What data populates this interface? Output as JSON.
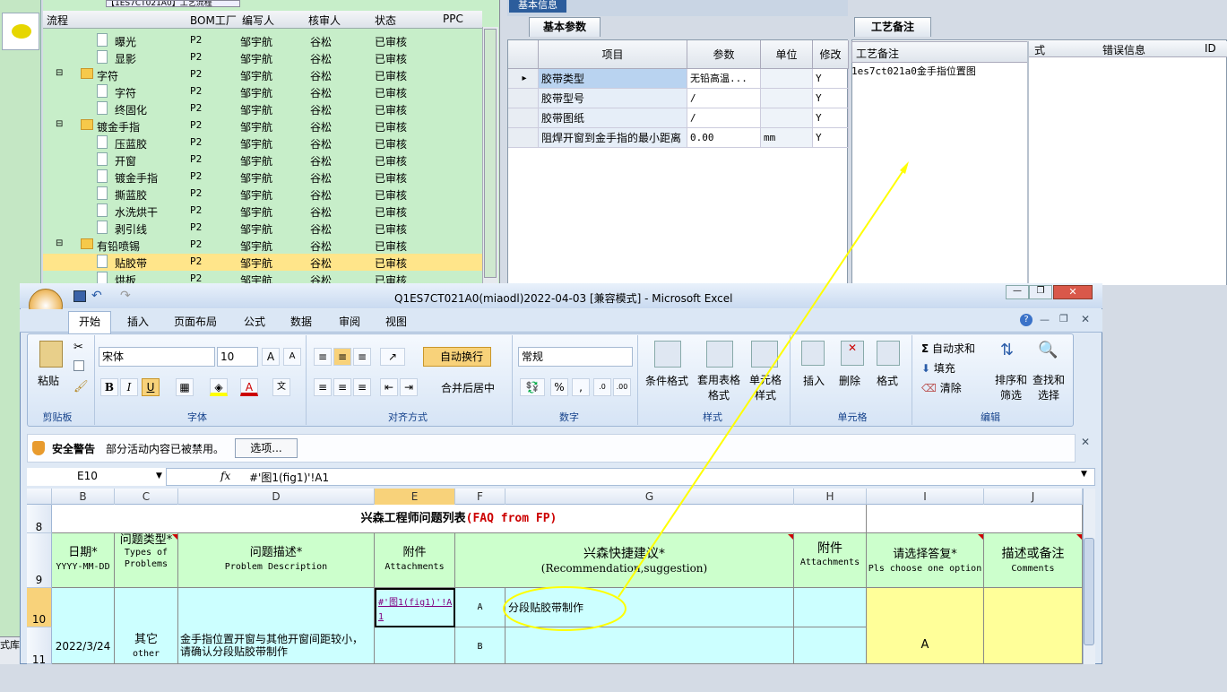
{
  "tree_panel": {
    "top_label": "【1ES7CT021A0】工艺流程",
    "headers": [
      "流程",
      "BOM工厂",
      "编写人",
      "核审人",
      "状态",
      "PPC"
    ],
    "rows": [
      {
        "name": "曝光",
        "indent": 2,
        "folder": false,
        "bom": "P2",
        "writer": "邹宇航",
        "reviewer": "谷松",
        "status": "已审核"
      },
      {
        "name": "显影",
        "indent": 2,
        "folder": false,
        "bom": "P2",
        "writer": "邹宇航",
        "reviewer": "谷松",
        "status": "已审核"
      },
      {
        "name": "字符",
        "indent": 1,
        "folder": true,
        "bom": "P2",
        "writer": "邹宇航",
        "reviewer": "谷松",
        "status": "已审核"
      },
      {
        "name": "字符",
        "indent": 2,
        "folder": false,
        "bom": "P2",
        "writer": "邹宇航",
        "reviewer": "谷松",
        "status": "已审核"
      },
      {
        "name": "终固化",
        "indent": 2,
        "folder": false,
        "bom": "P2",
        "writer": "邹宇航",
        "reviewer": "谷松",
        "status": "已审核"
      },
      {
        "name": "镀金手指",
        "indent": 1,
        "folder": true,
        "bom": "P2",
        "writer": "邹宇航",
        "reviewer": "谷松",
        "status": "已审核"
      },
      {
        "name": "压蓝胶",
        "indent": 2,
        "folder": false,
        "bom": "P2",
        "writer": "邹宇航",
        "reviewer": "谷松",
        "status": "已审核"
      },
      {
        "name": "开窗",
        "indent": 2,
        "folder": false,
        "bom": "P2",
        "writer": "邹宇航",
        "reviewer": "谷松",
        "status": "已审核"
      },
      {
        "name": "镀金手指",
        "indent": 2,
        "folder": false,
        "bom": "P2",
        "writer": "邹宇航",
        "reviewer": "谷松",
        "status": "已审核"
      },
      {
        "name": "撕蓝胶",
        "indent": 2,
        "folder": false,
        "bom": "P2",
        "writer": "邹宇航",
        "reviewer": "谷松",
        "status": "已审核"
      },
      {
        "name": "水洗烘干",
        "indent": 2,
        "folder": false,
        "bom": "P2",
        "writer": "邹宇航",
        "reviewer": "谷松",
        "status": "已审核"
      },
      {
        "name": "剥引线",
        "indent": 2,
        "folder": false,
        "bom": "P2",
        "writer": "邹宇航",
        "reviewer": "谷松",
        "status": "已审核"
      },
      {
        "name": "有铅喷锡",
        "indent": 1,
        "folder": true,
        "bom": "P2",
        "writer": "邹宇航",
        "reviewer": "谷松",
        "status": "已审核"
      },
      {
        "name": "贴胶带",
        "indent": 2,
        "folder": false,
        "bom": "P2",
        "writer": "邹宇航",
        "reviewer": "谷松",
        "status": "已审核",
        "selected": true
      },
      {
        "name": "烘板",
        "indent": 2,
        "folder": false,
        "bom": "P2",
        "writer": "邹宇航",
        "reviewer": "谷松",
        "status": "已审核"
      }
    ]
  },
  "params_panel": {
    "title": "基本信息",
    "tab": "基本参数",
    "headers": [
      "项目",
      "参数",
      "单位",
      "修改"
    ],
    "rows": [
      {
        "item": "胶带类型",
        "param": "无铅高温...",
        "unit": "",
        "mod": "Y"
      },
      {
        "item": "胶带型号",
        "param": "/",
        "unit": "",
        "mod": "Y"
      },
      {
        "item": "胶带图纸",
        "param": "/",
        "unit": "",
        "mod": "Y"
      },
      {
        "item": "阻焊开窗到金手指的最小距离",
        "param": "0.00",
        "unit": "mm",
        "mod": "Y"
      }
    ]
  },
  "notes_panel": {
    "tab": "工艺备注",
    "header": "工艺备注",
    "value": "1es7ct021a0金手指位置图",
    "other_headers": [
      "式",
      "错误信息",
      "ID"
    ]
  },
  "excel": {
    "title": "Q1ES7CT021A0(miaodl)2022-04-03  [兼容模式] - Microsoft Excel",
    "tabs": [
      "开始",
      "插入",
      "页面布局",
      "公式",
      "数据",
      "审阅",
      "视图"
    ],
    "clipboard": {
      "paste": "粘贴",
      "group": "剪贴板"
    },
    "font": {
      "name": "宋体",
      "size": "10",
      "group": "字体",
      "bold": "B",
      "italic": "I",
      "underline": "U"
    },
    "align": {
      "wrap": "自动换行",
      "merge": "合并后居中",
      "group": "对齐方式"
    },
    "number": {
      "format": "常规",
      "group": "数字",
      "percent": "%",
      "comma": ","
    },
    "styles": {
      "cond": "条件格式",
      "table": "套用表格格式",
      "cell": "单元格样式",
      "group": "样式"
    },
    "cells": {
      "insert": "插入",
      "delete": "删除",
      "format": "格式",
      "group": "单元格"
    },
    "editing": {
      "autosum": "自动求和",
      "fill": "填充",
      "clear": "清除",
      "sort": "排序和筛选",
      "find": "查找和选择",
      "group": "编辑"
    },
    "security": {
      "label": "安全警告",
      "message": "部分活动内容已被禁用。",
      "button": "选项..."
    },
    "namebox": "E10",
    "fx": "fx",
    "formula": "#'图1(fig1)'!A1",
    "columns": [
      "B",
      "C",
      "D",
      "E",
      "F",
      "G",
      "H",
      "I",
      "J"
    ],
    "rows_nums": [
      "8",
      "9",
      "10",
      "11"
    ],
    "sheet_title": "兴森工程师问题列表",
    "sheet_title_red": "(FAQ from FP)",
    "headers": {
      "date_cn": "日期*",
      "date_en": "YYYY-MM-DD",
      "type_cn": "问题类型*",
      "type_en": "Types of Problems",
      "desc_cn": "问题描述*",
      "desc_en": "Problem Description",
      "att_cn": "附件",
      "att_en": "Attachments",
      "rec_cn": "兴森快捷建议*",
      "rec_en": "(Recommendation,suggestion)",
      "att2_cn": "附件",
      "att2_en": "Attachments",
      "choose_cn": "请选择答复*",
      "choose_en": "Pls choose one option",
      "comments_cn": "描述或备注",
      "comments_en": "Comments"
    },
    "data": {
      "date": "2022/3/24",
      "type_cn": "其它",
      "type_en": "other",
      "desc": "金手指位置开窗与其他开窗间距较小，请确认分段贴胶带制作",
      "link": "#'图1(fig1)'!A1",
      "opt_a": "A",
      "opt_b": "B",
      "suggestion_a": "分段贴胶带制作",
      "answer": "A"
    }
  },
  "left_fragment": "式库",
  "accent": "#ffff00"
}
